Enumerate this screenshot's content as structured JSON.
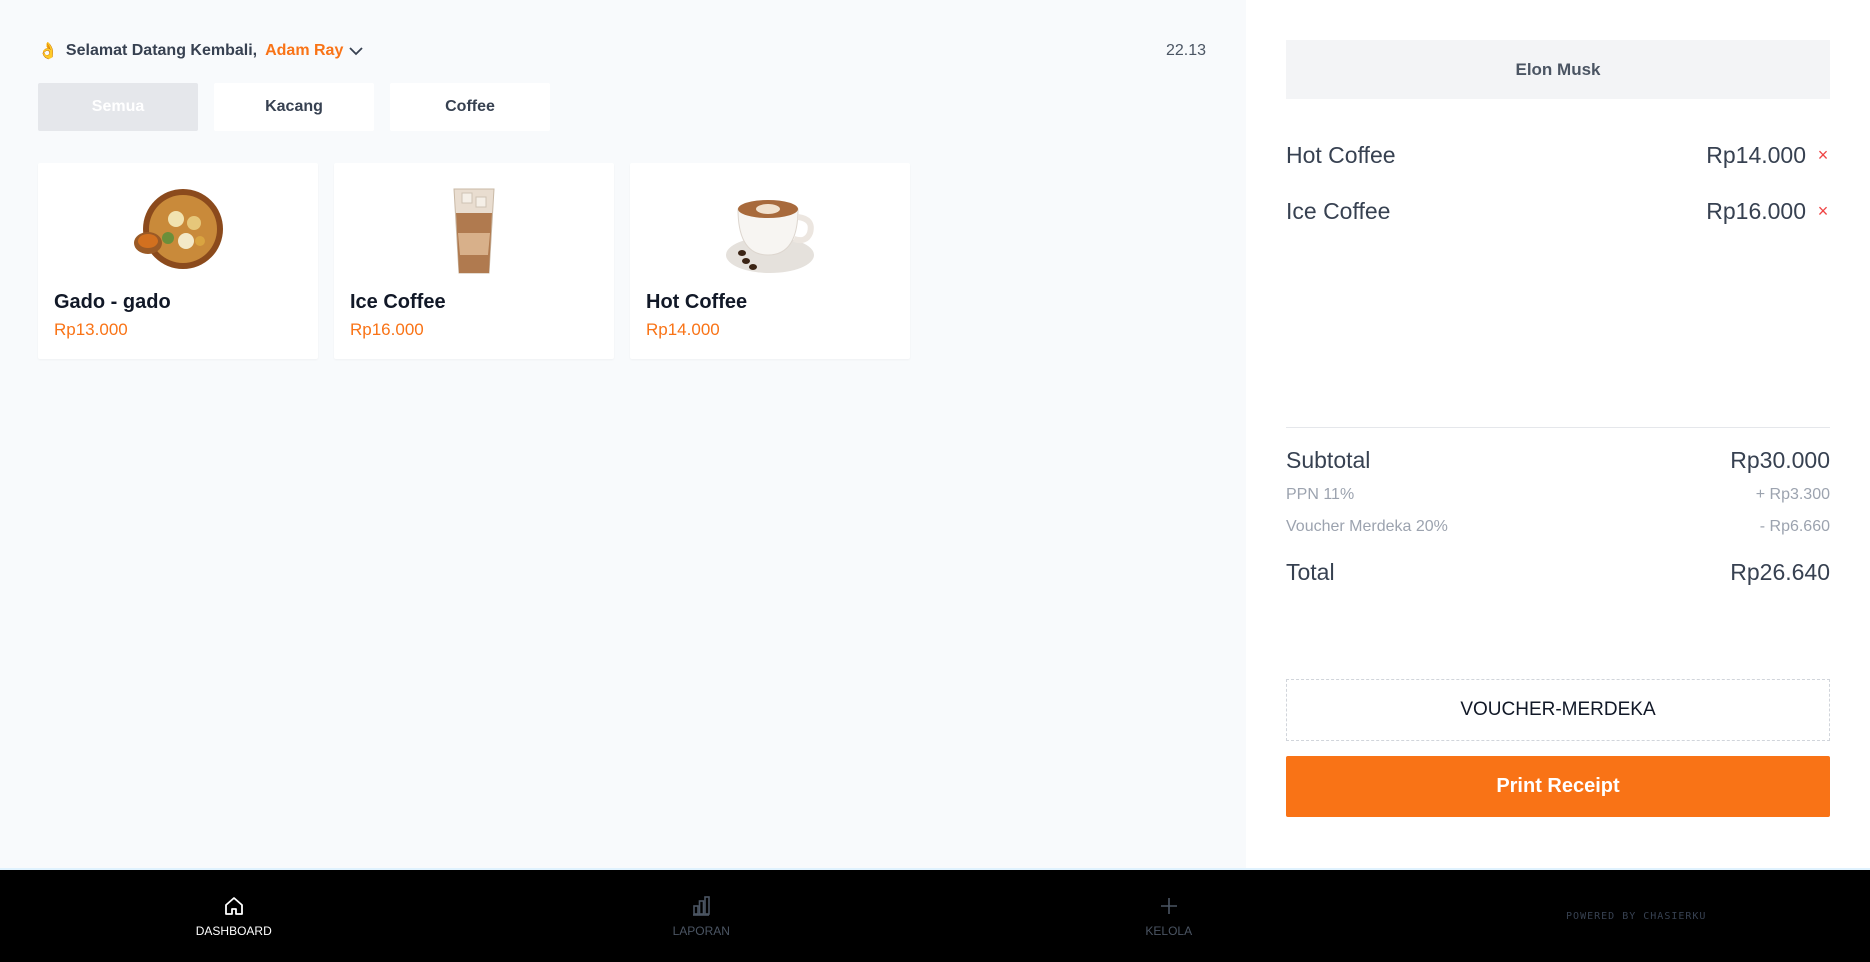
{
  "header": {
    "wave_emoji": "👌",
    "greeting": "Selamat Datang Kembali,",
    "user_name": "Adam Ray",
    "time": "22.13"
  },
  "categories": [
    {
      "label": "Semua",
      "active": true
    },
    {
      "label": "Kacang",
      "active": false
    },
    {
      "label": "Coffee",
      "active": false
    }
  ],
  "products": [
    {
      "name": "Gado - gado",
      "price": "Rp13.000",
      "icon": "salad-bowl-icon"
    },
    {
      "name": "Ice Coffee",
      "price": "Rp16.000",
      "icon": "iced-coffee-glass-icon"
    },
    {
      "name": "Hot Coffee",
      "price": "Rp14.000",
      "icon": "coffee-cup-icon"
    }
  ],
  "order": {
    "customer": "Elon Musk",
    "items": [
      {
        "name": "Hot Coffee",
        "price": "Rp14.000",
        "remove": "×"
      },
      {
        "name": "Ice Coffee",
        "price": "Rp16.000",
        "remove": "×"
      }
    ],
    "subtotal_label": "Subtotal",
    "subtotal_value": "Rp30.000",
    "tax_label": "PPN 11%",
    "tax_value": "+ Rp3.300",
    "voucher_label": "Voucher Merdeka 20%",
    "voucher_value": "- Rp6.660",
    "total_label": "Total",
    "total_value": "Rp26.640",
    "voucher_code": "VOUCHER-MERDEKA",
    "print_label": "Print Receipt"
  },
  "nav": {
    "items": [
      {
        "label": "DASHBOARD",
        "icon": "home-icon",
        "active": true
      },
      {
        "label": "LAPORAN",
        "icon": "bar-chart-icon",
        "active": false
      },
      {
        "label": "KELOLA",
        "icon": "plus-icon",
        "active": false
      }
    ],
    "powered": "POWERED BY CHASIERKU"
  },
  "colors": {
    "accent": "#f97316",
    "danger": "#ef4444",
    "panel_bg": "#f8fafc",
    "nav_bg": "#000000"
  }
}
